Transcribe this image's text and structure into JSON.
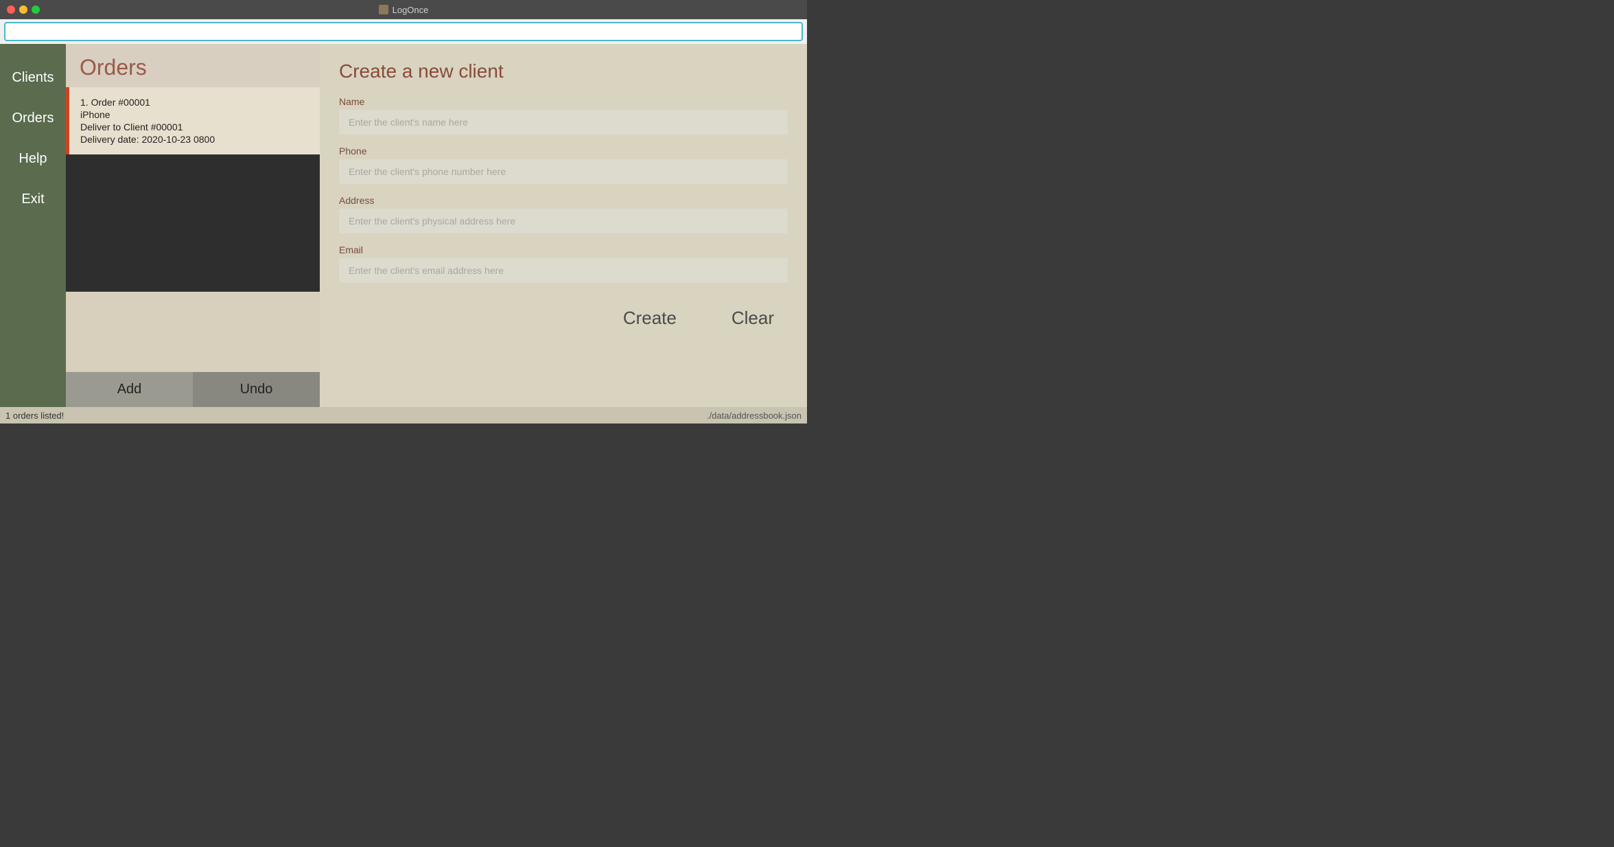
{
  "app": {
    "title": "LogOnce"
  },
  "search": {
    "placeholder": "",
    "value": ""
  },
  "sidebar": {
    "items": [
      {
        "label": "Clients",
        "id": "clients"
      },
      {
        "label": "Orders",
        "id": "orders"
      },
      {
        "label": "Help",
        "id": "help"
      },
      {
        "label": "Exit",
        "id": "exit"
      }
    ]
  },
  "orders_panel": {
    "title": "Orders",
    "items": [
      {
        "number": "1.  Order #00001",
        "product": "iPhone",
        "client": "Deliver to Client #00001",
        "date": "Delivery date: 2020-10-23 0800"
      }
    ],
    "add_button": "Add",
    "undo_button": "Undo"
  },
  "create_client": {
    "title": "Create a new client",
    "fields": {
      "name": {
        "label": "Name",
        "placeholder": "Enter the client's name here"
      },
      "phone": {
        "label": "Phone",
        "placeholder": "Enter the client's phone number here"
      },
      "address": {
        "label": "Address",
        "placeholder": "Enter the client's physical address here"
      },
      "email": {
        "label": "Email",
        "placeholder": "Enter the client's email address here"
      }
    },
    "create_button": "Create",
    "clear_button": "Clear"
  },
  "status": {
    "left": "1 orders listed!",
    "right": "./data/addressbook.json"
  }
}
